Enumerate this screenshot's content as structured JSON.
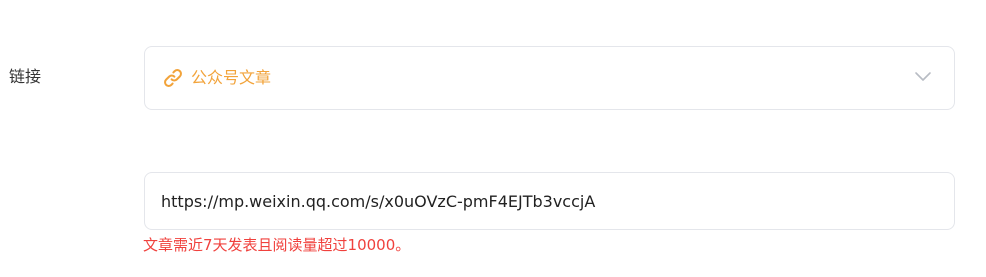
{
  "form": {
    "label": "链接",
    "link_select": {
      "selected": "公众号文章",
      "icon": "link-icon",
      "chevron": "chevron-down-icon"
    },
    "url_input": {
      "value": "https://mp.weixin.qq.com/s/x0uOVzC-pmF4EJTb3vccjA"
    },
    "error_message": "文章需近7天发表且阅读量超过10000。"
  },
  "colors": {
    "accent": "#f2a33a",
    "error": "#f0413d",
    "border": "#e4e6eb",
    "label": "#333333",
    "chevron": "#b8bcc4"
  }
}
